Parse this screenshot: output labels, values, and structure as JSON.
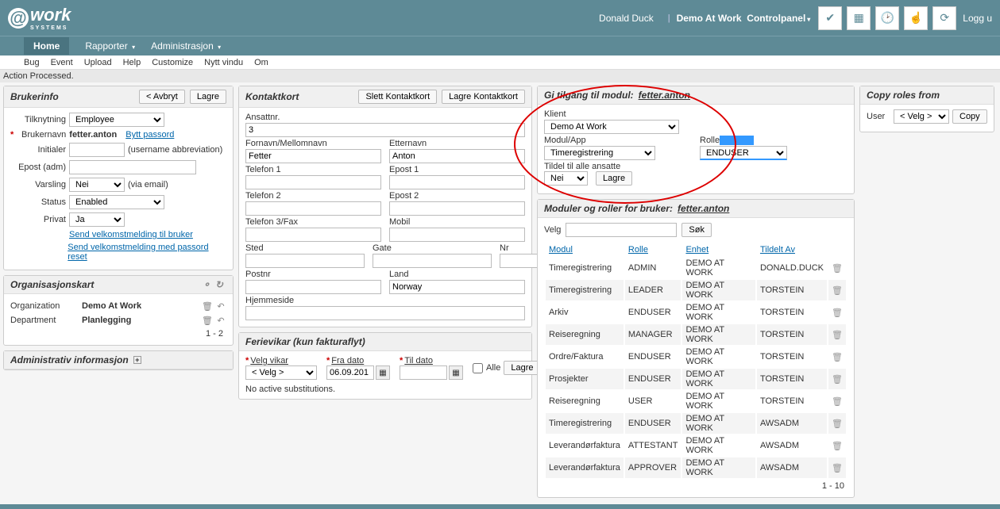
{
  "header": {
    "logo_main": "work",
    "logo_sub": "SYSTEMS",
    "user": "Donald Duck",
    "demo_link": "Demo At Work",
    "controlpanel": "Controlpanel",
    "logout": "Logg u"
  },
  "nav": {
    "home": "Home",
    "rapporter": "Rapporter",
    "admin": "Administrasjon"
  },
  "submenu": {
    "bug": "Bug",
    "event": "Event",
    "upload": "Upload",
    "help": "Help",
    "customize": "Customize",
    "nytt": "Nytt vindu",
    "om": "Om"
  },
  "status": "Action Processed.",
  "brukerinfo": {
    "title": "Brukerinfo",
    "avbryt": "< Avbryt",
    "lagre": "Lagre",
    "tilknytning_lbl": "Tilknytning",
    "tilknytning_val": "Employee",
    "brukernavn_lbl": "Brukernavn",
    "brukernavn_val": "fetter.anton",
    "bytt_passord": "Bytt passord",
    "initialer_lbl": "Initialer",
    "initialer_hint": "(username abbreviation)",
    "epost_lbl": "Epost (adm)",
    "varsling_lbl": "Varsling",
    "varsling_val": "Nei",
    "varsling_hint": "(via email)",
    "status_lbl": "Status",
    "status_val": "Enabled",
    "privat_lbl": "Privat",
    "privat_val": "Ja",
    "send1": "Send velkomstmelding til bruker",
    "send2": "Send velkomstmelding med passord reset"
  },
  "org": {
    "title": "Organisasjonskart",
    "r1_lbl": "Organization",
    "r1_val": "Demo At Work",
    "r2_lbl": "Department",
    "r2_val": "Planlegging",
    "pager": "1 - 2"
  },
  "admin_info": {
    "title": "Administrativ informasjon"
  },
  "kontakt": {
    "title": "Kontaktkort",
    "slett": "Slett Kontaktkort",
    "lagre": "Lagre Kontaktkort",
    "ansattnr_lbl": "Ansattnr.",
    "ansattnr_val": "3",
    "fornavn_lbl": "Fornavn/Mellomnavn",
    "fornavn_val": "Fetter",
    "etternavn_lbl": "Etternavn",
    "etternavn_val": "Anton",
    "tel1_lbl": "Telefon 1",
    "epost1_lbl": "Epost 1",
    "tel2_lbl": "Telefon 2",
    "epost2_lbl": "Epost 2",
    "tel3_lbl": "Telefon 3/Fax",
    "mobil_lbl": "Mobil",
    "sted_lbl": "Sted",
    "gate_lbl": "Gate",
    "nr_lbl": "Nr",
    "postnr_lbl": "Postnr",
    "land_lbl": "Land",
    "land_val": "Norway",
    "hjemmeside_lbl": "Hjemmeside"
  },
  "ferie": {
    "title": "Ferievikar (kun fakturaflyt)",
    "velg_lbl": "Velg vikar",
    "velg_val": "< Velg >",
    "fra_lbl": "Fra dato",
    "fra_val": "06.09.201",
    "til_lbl": "Til dato",
    "alle": "Alle",
    "lagre": "Lagre",
    "noactive": "No active substitutions."
  },
  "access": {
    "title_pre": "Gi tilgang til modul:",
    "title_user": "fetter.anton",
    "klient_lbl": "Klient",
    "klient_val": "Demo At Work",
    "modul_lbl": "Modul/App",
    "modul_val": "Timeregistrering",
    "rolle_lbl": "Rolle",
    "rolle_val": "ENDUSER",
    "tildel_lbl": "Tildel til alle ansatte",
    "tildel_val": "Nei",
    "lagre": "Lagre"
  },
  "modules": {
    "title_pre": "Moduler og roller for bruker:",
    "title_user": "fetter.anton",
    "velg_lbl": "Velg",
    "sok": "Søk",
    "h_modul": "Modul",
    "h_rolle": "Rolle",
    "h_enhet": "Enhet",
    "h_tildelt": "Tildelt Av",
    "rows": [
      {
        "m": "Timeregistrering",
        "r": "ADMIN",
        "e": "DEMO AT WORK",
        "t": "DONALD.DUCK"
      },
      {
        "m": "Timeregistrering",
        "r": "LEADER",
        "e": "DEMO AT WORK",
        "t": "TORSTEIN"
      },
      {
        "m": "Arkiv",
        "r": "ENDUSER",
        "e": "DEMO AT WORK",
        "t": "TORSTEIN"
      },
      {
        "m": "Reiseregning",
        "r": "MANAGER",
        "e": "DEMO AT WORK",
        "t": "TORSTEIN"
      },
      {
        "m": "Ordre/Faktura",
        "r": "ENDUSER",
        "e": "DEMO AT WORK",
        "t": "TORSTEIN"
      },
      {
        "m": "Prosjekter",
        "r": "ENDUSER",
        "e": "DEMO AT WORK",
        "t": "TORSTEIN"
      },
      {
        "m": "Reiseregning",
        "r": "USER",
        "e": "DEMO AT WORK",
        "t": "TORSTEIN"
      },
      {
        "m": "Timeregistrering",
        "r": "ENDUSER",
        "e": "DEMO AT WORK",
        "t": "AWSADM"
      },
      {
        "m": "Leverandørfaktura",
        "r": "ATTESTANT",
        "e": "DEMO AT WORK",
        "t": "AWSADM"
      },
      {
        "m": "Leverandørfaktura",
        "r": "APPROVER",
        "e": "DEMO AT WORK",
        "t": "AWSADM"
      }
    ],
    "pager": "1 - 10"
  },
  "copy": {
    "title": "Copy roles from",
    "user_lbl": "User",
    "user_val": "< Velg >",
    "copy_btn": "Copy"
  }
}
